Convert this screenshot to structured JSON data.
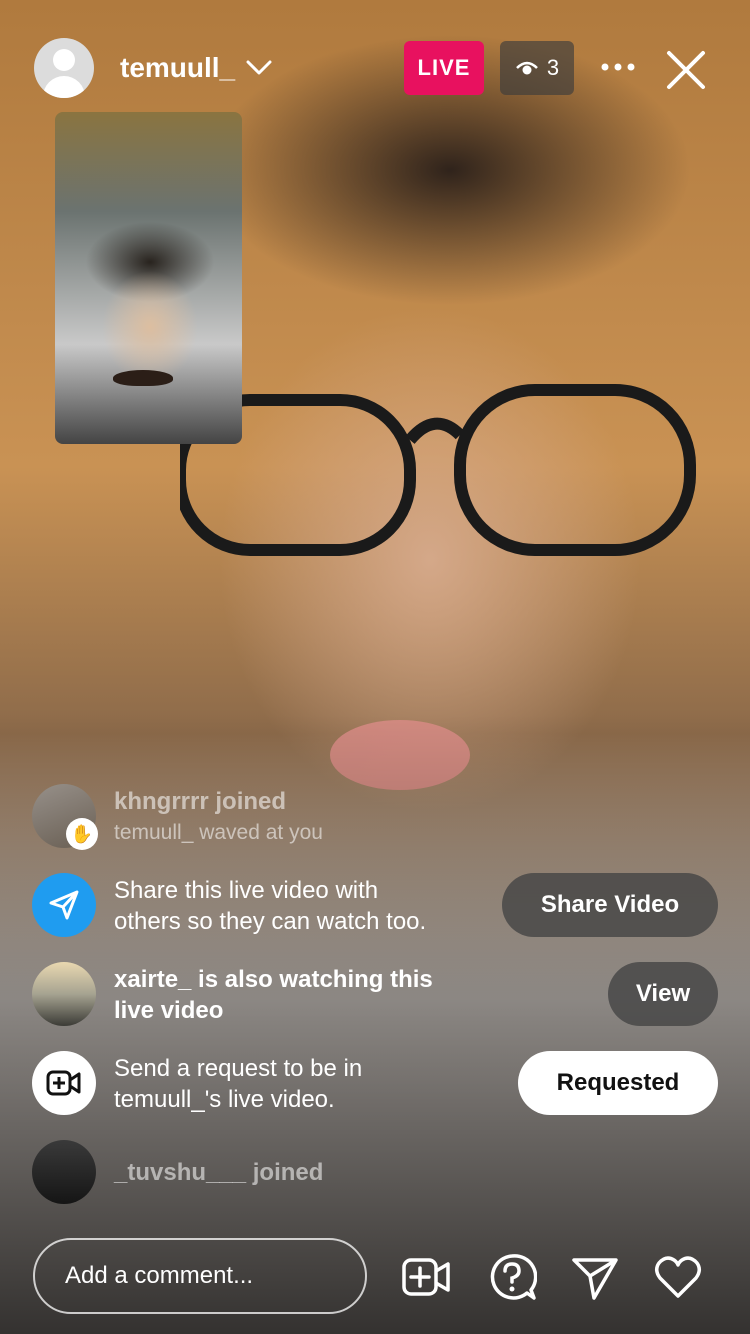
{
  "header": {
    "host_username": "temuull_",
    "live_label": "LIVE",
    "viewer_count": "3"
  },
  "feed": {
    "joined_1": {
      "username": "khngrrrr",
      "action": "joined"
    },
    "wave": {
      "text": "temuull_ waved at you"
    },
    "share": {
      "text_line1": "Share this live video with",
      "text_line2": "others so they can watch too.",
      "button": "Share Video"
    },
    "watching": {
      "text_line1": "xairte_ is also watching this",
      "text_line2": "live video",
      "button": "View"
    },
    "request": {
      "text_line1": "Send a request to be in",
      "text_line2": "temuull_'s live video.",
      "button": "Requested"
    },
    "joined_2": {
      "username": "_tuvshu___",
      "action": "joined"
    }
  },
  "footer": {
    "comment_placeholder": "Add a comment..."
  },
  "colors": {
    "live_badge": "#e8115f",
    "share_icon_bg": "#1f9cf0"
  },
  "icons": [
    "chevron-down-icon",
    "eye-icon",
    "more-icon",
    "close-icon",
    "wave-icon",
    "paper-plane-icon",
    "video-add-icon",
    "question-icon",
    "send-icon",
    "heart-icon"
  ]
}
